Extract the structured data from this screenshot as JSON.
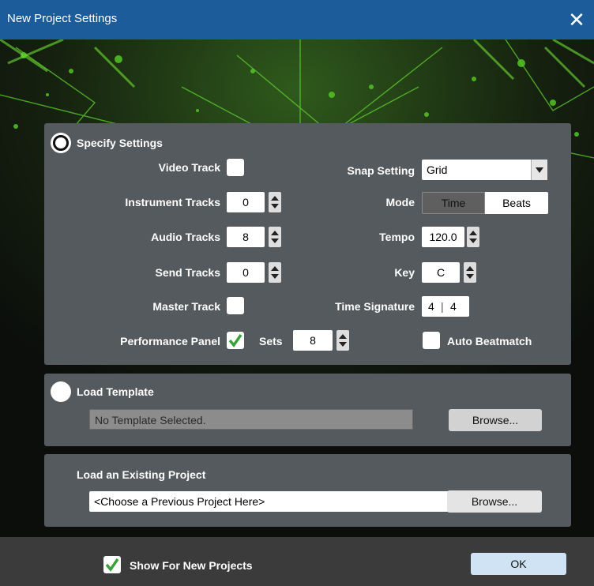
{
  "window": {
    "title": "New Project Settings",
    "close_glyph": "✕"
  },
  "specify": {
    "label": "Specify Settings",
    "video_track": {
      "label": "Video Track",
      "checked": false
    },
    "instrument_tracks": {
      "label": "Instrument Tracks",
      "value": "0"
    },
    "audio_tracks": {
      "label": "Audio Tracks",
      "value": "8"
    },
    "send_tracks": {
      "label": "Send Tracks",
      "value": "0"
    },
    "master_track": {
      "label": "Master Track",
      "checked": false
    },
    "performance_panel": {
      "label": "Performance Panel",
      "checked": true
    },
    "sets": {
      "label": "Sets",
      "value": "8"
    },
    "snap_setting": {
      "label": "Snap Setting",
      "value": "Grid"
    },
    "mode": {
      "label": "Mode",
      "options": [
        "Time",
        "Beats"
      ],
      "selected": "Beats"
    },
    "tempo": {
      "label": "Tempo",
      "value": "120.0"
    },
    "key": {
      "label": "Key",
      "value": "C"
    },
    "time_signature": {
      "label": "Time Signature",
      "numerator": "4",
      "separator": "|",
      "denominator": "4"
    },
    "auto_beatmatch": {
      "label": "Auto Beatmatch",
      "checked": false
    }
  },
  "template": {
    "label": "Load Template",
    "field_value": "No Template Selected.",
    "browse_label": "Browse..."
  },
  "existing": {
    "label": "Load an Existing Project",
    "select_value": "<Choose a Previous Project Here>",
    "browse_label": "Browse..."
  },
  "footer": {
    "show_label": "Show For New Projects",
    "show_checked": true,
    "ok_label": "OK"
  },
  "colors": {
    "title_bar": "#1c5c9a",
    "panel": "#545a5d",
    "check_green": "#3aa13a",
    "footer": "#3b3b3b"
  }
}
